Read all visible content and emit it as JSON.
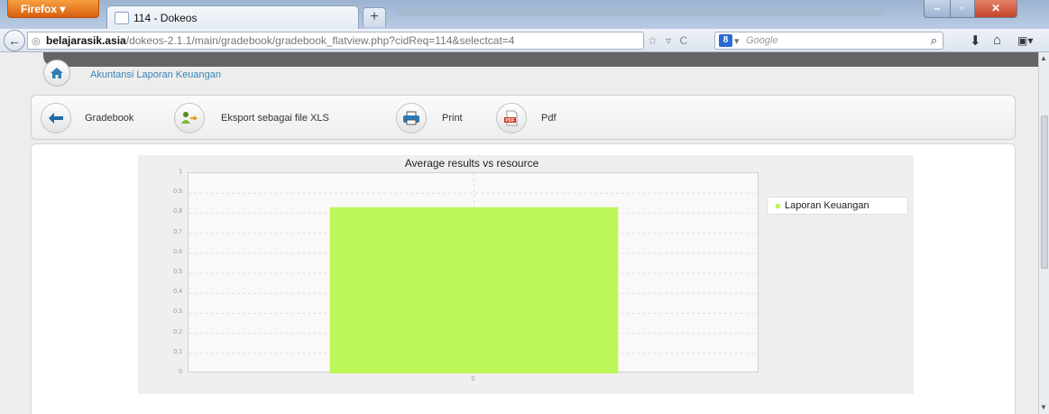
{
  "browser": {
    "app_button_label": "Firefox ▾",
    "tab_title": "114 - Dokeos",
    "new_tab_label": "+",
    "url_host": "belajarasik.asia",
    "url_path": "/dokeos-2.1.1/main/gradebook/gradebook_flatview.php?cidReq=114&selectcat=4",
    "url_controls": "☆ ▿ C",
    "search_engine_icon": "8",
    "search_dropdown": "▾",
    "search_placeholder": "Google",
    "search_go_icon": "⌕",
    "icons": [
      "back-arrow-icon",
      "globe-icon",
      "download-arrow-icon",
      "home-icon",
      "bookmarks-menu-icon"
    ]
  },
  "page": {
    "course_title": "Akuntansi Laporan Keuangan",
    "toolbar": {
      "gradebook_label": "Gradebook",
      "export_xls_label": "Eksport sebagai file XLS",
      "print_label": "Print",
      "pdf_label": "Pdf"
    }
  },
  "colors": {
    "bar": "#bdf658",
    "link": "#3a83b5",
    "header_strip": "#646464"
  },
  "chart_data": {
    "type": "bar",
    "title": "Average results vs resource",
    "categories": [
      "0"
    ],
    "series": [
      {
        "name": "Laporan Keuangan",
        "values": [
          0.83
        ]
      }
    ],
    "y_ticks": [
      "0",
      "0.1",
      "0.2",
      "0.3",
      "0.4",
      "0.5",
      "0.6",
      "0.7",
      "0.8",
      "0.9",
      "1"
    ],
    "ylim": [
      0,
      1
    ],
    "xlabel": "",
    "ylabel": "",
    "grid": true,
    "legend_position": "right"
  }
}
